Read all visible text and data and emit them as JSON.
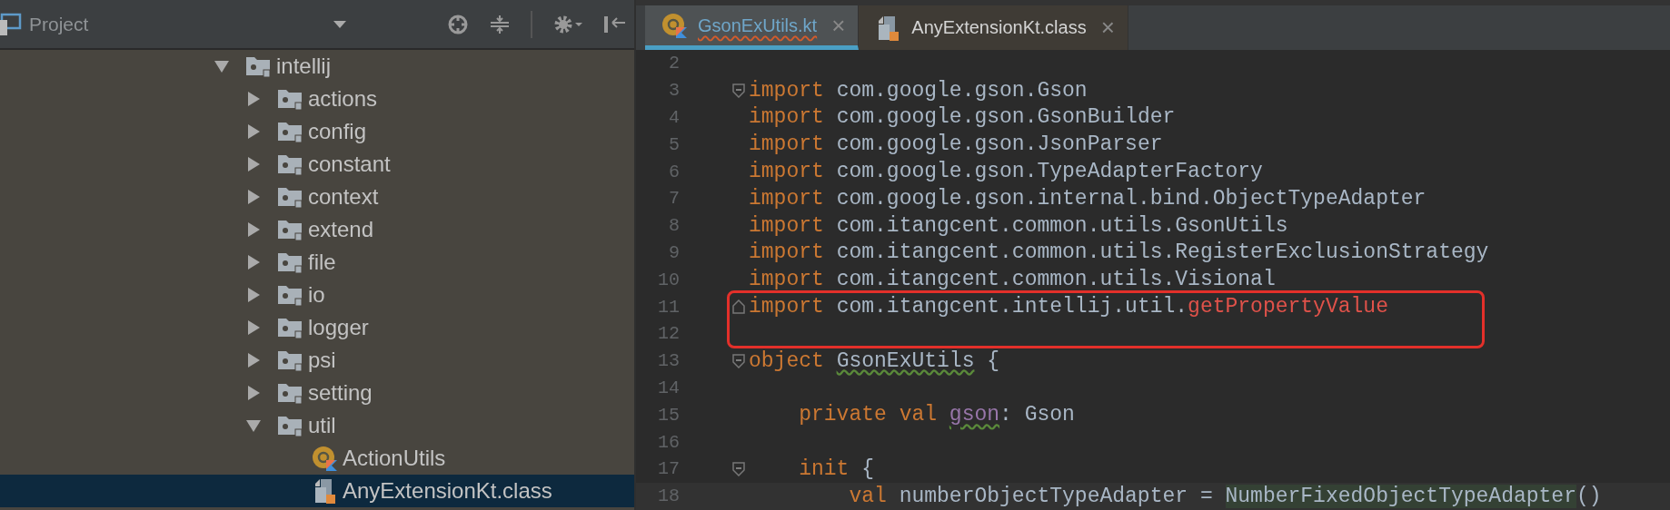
{
  "project_panel": {
    "title": "Project",
    "tree": [
      {
        "label": "intellij",
        "kind": "folder",
        "expanded": true,
        "selected": false,
        "children": [
          {
            "label": "actions",
            "kind": "folder",
            "expanded": false,
            "selected": false
          },
          {
            "label": "config",
            "kind": "folder",
            "expanded": false,
            "selected": false
          },
          {
            "label": "constant",
            "kind": "folder",
            "expanded": false,
            "selected": false
          },
          {
            "label": "context",
            "kind": "folder",
            "expanded": false,
            "selected": false
          },
          {
            "label": "extend",
            "kind": "folder",
            "expanded": false,
            "selected": false
          },
          {
            "label": "file",
            "kind": "folder",
            "expanded": false,
            "selected": false
          },
          {
            "label": "io",
            "kind": "folder",
            "expanded": false,
            "selected": false
          },
          {
            "label": "logger",
            "kind": "folder",
            "expanded": false,
            "selected": false
          },
          {
            "label": "psi",
            "kind": "folder",
            "expanded": false,
            "selected": false
          },
          {
            "label": "setting",
            "kind": "folder",
            "expanded": false,
            "selected": false
          },
          {
            "label": "util",
            "kind": "folder",
            "expanded": true,
            "selected": false,
            "children": [
              {
                "label": "ActionUtils",
                "kind": "kotlin",
                "selected": false
              },
              {
                "label": "AnyExtensionKt.class",
                "kind": "class",
                "selected": true
              }
            ]
          }
        ]
      }
    ]
  },
  "editor": {
    "tabs": [
      {
        "label": "GsonExUtils.kt",
        "kind": "kotlin",
        "selected": true,
        "error": true,
        "close": "×"
      },
      {
        "label": "AnyExtensionKt.class",
        "kind": "class",
        "selected": false,
        "error": false,
        "close": "×"
      }
    ],
    "lines": [
      {
        "number": "2"
      },
      {
        "number": "3",
        "fold_start": true,
        "segments": [
          {
            "text": "import",
            "kind": "keyword"
          },
          {
            "text": " com.google.gson.Gson",
            "kind": "plain"
          }
        ]
      },
      {
        "number": "4",
        "segments": [
          {
            "text": "import",
            "kind": "keyword"
          },
          {
            "text": " com.google.gson.GsonBuilder",
            "kind": "plain"
          }
        ]
      },
      {
        "number": "5",
        "segments": [
          {
            "text": "import",
            "kind": "keyword"
          },
          {
            "text": " com.google.gson.JsonParser",
            "kind": "plain"
          }
        ]
      },
      {
        "number": "6",
        "segments": [
          {
            "text": "import",
            "kind": "keyword"
          },
          {
            "text": " com.google.gson.TypeAdapterFactory",
            "kind": "plain"
          }
        ]
      },
      {
        "number": "7",
        "segments": [
          {
            "text": "import",
            "kind": "keyword"
          },
          {
            "text": " com.google.gson.internal.bind.ObjectTypeAdapter",
            "kind": "plain"
          }
        ]
      },
      {
        "number": "8",
        "segments": [
          {
            "text": "import",
            "kind": "keyword"
          },
          {
            "text": " com.itangcent.common.utils.GsonUtils",
            "kind": "plain"
          }
        ]
      },
      {
        "number": "9",
        "segments": [
          {
            "text": "import",
            "kind": "keyword"
          },
          {
            "text": " com.itangcent.common.utils.RegisterExclusionStrategy",
            "kind": "plain"
          }
        ]
      },
      {
        "number": "10",
        "segments": [
          {
            "text": "import",
            "kind": "keyword"
          },
          {
            "text": " com.itangcent.common.utils.Visional",
            "kind": "plain"
          }
        ]
      },
      {
        "number": "11",
        "fold_end": true,
        "segments": [
          {
            "text": "import",
            "kind": "keyword"
          },
          {
            "text": " com.itangcent.intellij.util.",
            "kind": "plain"
          },
          {
            "text": "getPropertyValue",
            "kind": "unresolved"
          }
        ]
      },
      {
        "number": "12"
      },
      {
        "number": "13",
        "fold_start": true,
        "segments": [
          {
            "text": "object ",
            "kind": "keyword"
          },
          {
            "text": "GsonExUtils",
            "kind": "plain",
            "typo": true
          },
          {
            "text": " {",
            "kind": "plain"
          }
        ]
      },
      {
        "number": "14"
      },
      {
        "number": "15",
        "segments": [
          {
            "text": "    private val ",
            "kind": "keyword"
          },
          {
            "text": "gson",
            "kind": "field",
            "typo": true
          },
          {
            "text": ": Gson",
            "kind": "plain"
          }
        ]
      },
      {
        "number": "16"
      },
      {
        "number": "17",
        "fold_start": true,
        "segments": [
          {
            "text": "    init",
            "kind": "keyword"
          },
          {
            "text": " {",
            "kind": "plain"
          }
        ]
      },
      {
        "number": "18",
        "current": true,
        "segments": [
          {
            "text": "        val",
            "kind": "keyword"
          },
          {
            "text": " numberObjectTypeAdapter = ",
            "kind": "plain"
          },
          {
            "text": "NumberFixedObjectTypeAdapter",
            "kind": "highlight"
          },
          {
            "text": "()",
            "kind": "plain"
          }
        ]
      }
    ]
  }
}
